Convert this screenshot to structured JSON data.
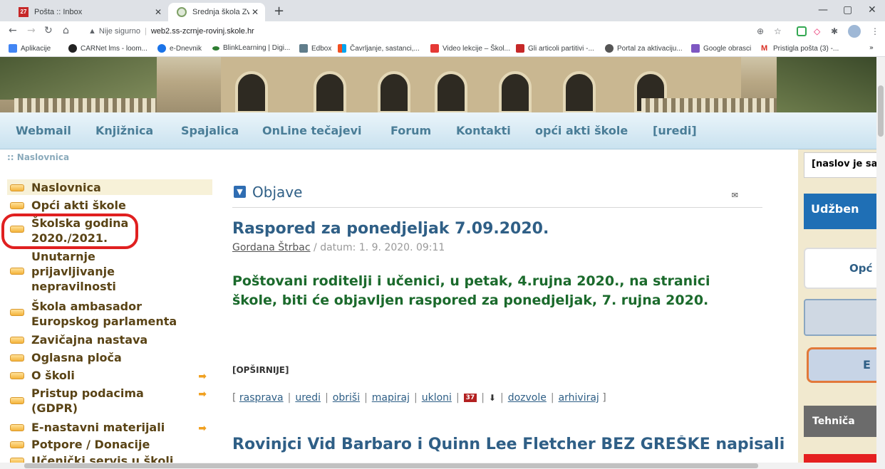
{
  "browser": {
    "tabs": [
      {
        "title": "Pošta :: Inbox",
        "favicon_text": "27"
      },
      {
        "title": "Srednja škola Zvane Črnje Rovinj"
      }
    ],
    "new_tab": "+",
    "close": "✕",
    "window": {
      "minimize": "—",
      "maximize": "▢",
      "close": "✕"
    },
    "security_warning": "Nije sigurno",
    "url": "web2.ss-zcrnje-rovinj.skole.hr",
    "bookmarks": [
      {
        "label": "Aplikacije",
        "color": "#4285f4"
      },
      {
        "label": "CARNet lms - loom...",
        "color": "#222222"
      },
      {
        "label": "e-Dnevnik",
        "color": "#1a73e8"
      },
      {
        "label": "BlinkLearning | Digi...",
        "color": "#2e7d32"
      },
      {
        "label": "Edbox",
        "color": "#607d8b"
      },
      {
        "label": "Čavrljanje, sastanci,...",
        "color": "#f4b400"
      },
      {
        "label": "Video lekcije – Škol...",
        "color": "#e53935"
      },
      {
        "label": "Gli articoli partitivi -...",
        "color": "#c62828"
      },
      {
        "label": "Portal za aktivaciju...",
        "color": "#555555"
      },
      {
        "label": "Google obrasci",
        "color": "#7e57c2"
      },
      {
        "label": "Pristigla pošta (3) -...",
        "color": "#d93025"
      }
    ],
    "bookmarks_more": "»"
  },
  "menu": [
    "Webmail",
    "Knjižnica",
    "Spajalica",
    "OnLine tečajevi",
    "Forum",
    "Kontakti",
    "opći akti škole",
    "[uredi]"
  ],
  "breadcrumb": ":: Naslovnica",
  "sidebar": {
    "items": [
      {
        "label": "Naslovnica",
        "arrow": ""
      },
      {
        "label": "Opći akti škole",
        "arrow": ""
      },
      {
        "label": "Školska godina 2020./2021.",
        "arrow": ""
      },
      {
        "label": "Unutarnje prijavljivanje nepravilnosti",
        "arrow": ""
      },
      {
        "label": "Škola ambasador Europskog parlamenta",
        "arrow": ""
      },
      {
        "label": "Zavičajna nastava",
        "arrow": ""
      },
      {
        "label": "Oglasna ploča",
        "arrow": ""
      },
      {
        "label": "O školi",
        "arrow": "➡"
      },
      {
        "label": "Pristup podacima (GDPR)",
        "arrow": "➡"
      },
      {
        "label": "E-nastavni materijali",
        "arrow": "➡"
      },
      {
        "label": "Potpore / Donacije",
        "arrow": ""
      },
      {
        "label": "Učenički servis u školi",
        "arrow": ""
      }
    ]
  },
  "main": {
    "section_title": "Objave",
    "post1": {
      "title": "Raspored za ponedjeljak 7.09.2020.",
      "author": "Gordana Štrbac",
      "meta": " / datum: 1. 9. 2020. 09:11",
      "body": "Poštovani roditelji i učenici, u petak, 4.rujna 2020., na stranici škole, biti će objavljen raspored za ponedjeljak, 7. rujna 2020.",
      "more": "[OPŠIRNIJE]",
      "actions": [
        "rasprava",
        "uredi",
        "obriši",
        "mapiraj",
        "ukloni"
      ],
      "badge": "37",
      "actions2": [
        "dozvole",
        "arhiviraj"
      ]
    },
    "post2": {
      "title": "Rovinjci Vid Barbaro i Quinn Lee Fletcher BEZ GREŠKE napisali"
    }
  },
  "right_column": [
    {
      "label": "[naslov je sa",
      "color": "#222222"
    },
    {
      "label": "Udžben",
      "color": "#ffffff"
    },
    {
      "label": "Opć",
      "color": "#2f5f86"
    },
    {
      "label": "",
      "color": "#2f5f86"
    },
    {
      "label": "E",
      "color": "#2f5f86"
    },
    {
      "label": "Tehniča",
      "color": "#ffffff"
    }
  ]
}
